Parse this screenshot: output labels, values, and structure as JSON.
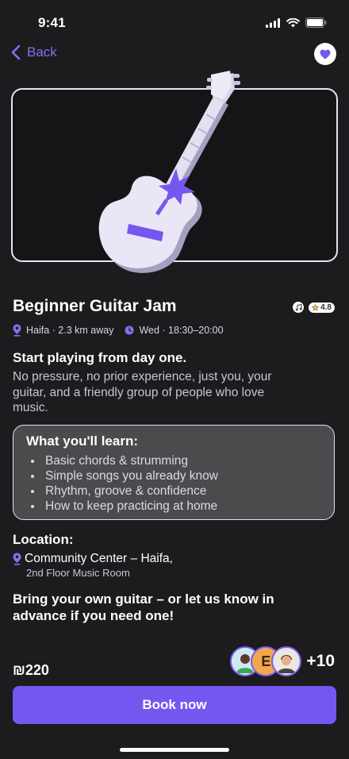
{
  "status": {
    "time": "9:41"
  },
  "nav": {
    "back_label": "Back"
  },
  "event": {
    "title": "Beginner Guitar Jam",
    "rating": "4.8",
    "location_short": "Haifa · 2.3 km away",
    "schedule": "Wed · 18:30–20:00",
    "subtitle": "Start playing from day one.",
    "description": "No pressure, no prior experience, just you, your guitar, and a friendly group of people who love music."
  },
  "learn": {
    "title": "What you'll learn:",
    "items": [
      "Basic chords & strumming",
      "Simple songs you already know",
      "Rhythm, groove & confidence",
      "How to keep practicing at home"
    ]
  },
  "location": {
    "title": "Location:",
    "venue": "Community Center – Haifa,",
    "room": "2nd Floor Music Room"
  },
  "note": "Bring your own guitar – or let us know in advance if you need one!",
  "footer": {
    "price": "₪220",
    "avatar_initial": "E",
    "more_count": "+10",
    "book_label": "Book now"
  },
  "colors": {
    "accent": "#7557f0",
    "background": "#1c1b1e",
    "card": "#4b4a4d"
  },
  "icons": [
    "signal-icon",
    "wifi-icon",
    "battery-icon",
    "chevron-left-icon",
    "heart-icon",
    "music-note-icon",
    "star-icon",
    "location-pin-icon",
    "clock-icon",
    "guitar-illustration"
  ]
}
